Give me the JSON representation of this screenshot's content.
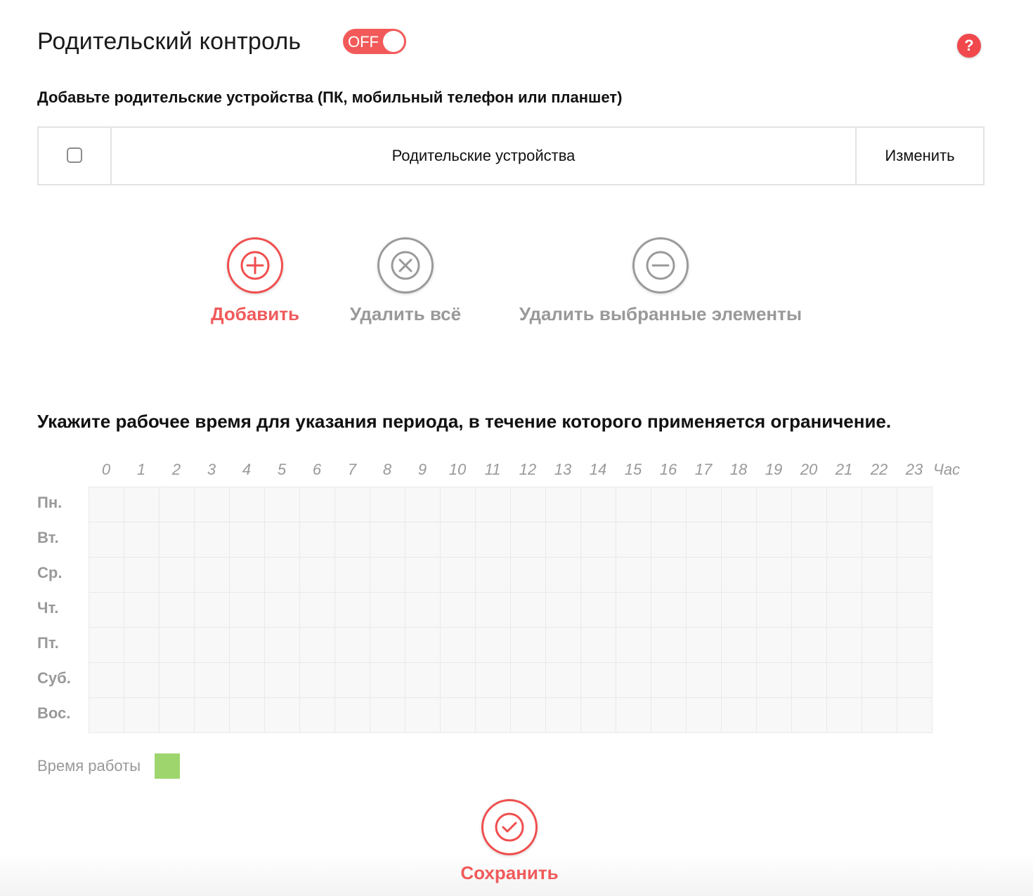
{
  "header": {
    "title": "Родительский контроль",
    "toggle_text": "OFF",
    "help_symbol": "?"
  },
  "devices": {
    "subtitle": "Добавьте родительские устройства (ПК, мобильный телефон или планшет)",
    "column_name": "Родительские устройства",
    "column_edit": "Изменить"
  },
  "actions": {
    "add_label": "Добавить",
    "delete_all_label": "Удалить всё",
    "delete_selected_label": "Удалить выбранные элементы"
  },
  "schedule": {
    "title": "Укажите рабочее время для указания периода, в течение которого применяется ограничение.",
    "hours": [
      "0",
      "1",
      "2",
      "3",
      "4",
      "5",
      "6",
      "7",
      "8",
      "9",
      "10",
      "11",
      "12",
      "13",
      "14",
      "15",
      "16",
      "17",
      "18",
      "19",
      "20",
      "21",
      "22",
      "23"
    ],
    "hour_unit": "Час",
    "days": [
      "Пн.",
      "Вт.",
      "Ср.",
      "Чт.",
      "Пт.",
      "Суб.",
      "Вос."
    ],
    "legend_label": "Время работы"
  },
  "footer": {
    "save_label": "Сохранить"
  },
  "colors": {
    "accent": "#f05a5a",
    "muted": "#999999",
    "work_time": "#9ed56c"
  }
}
